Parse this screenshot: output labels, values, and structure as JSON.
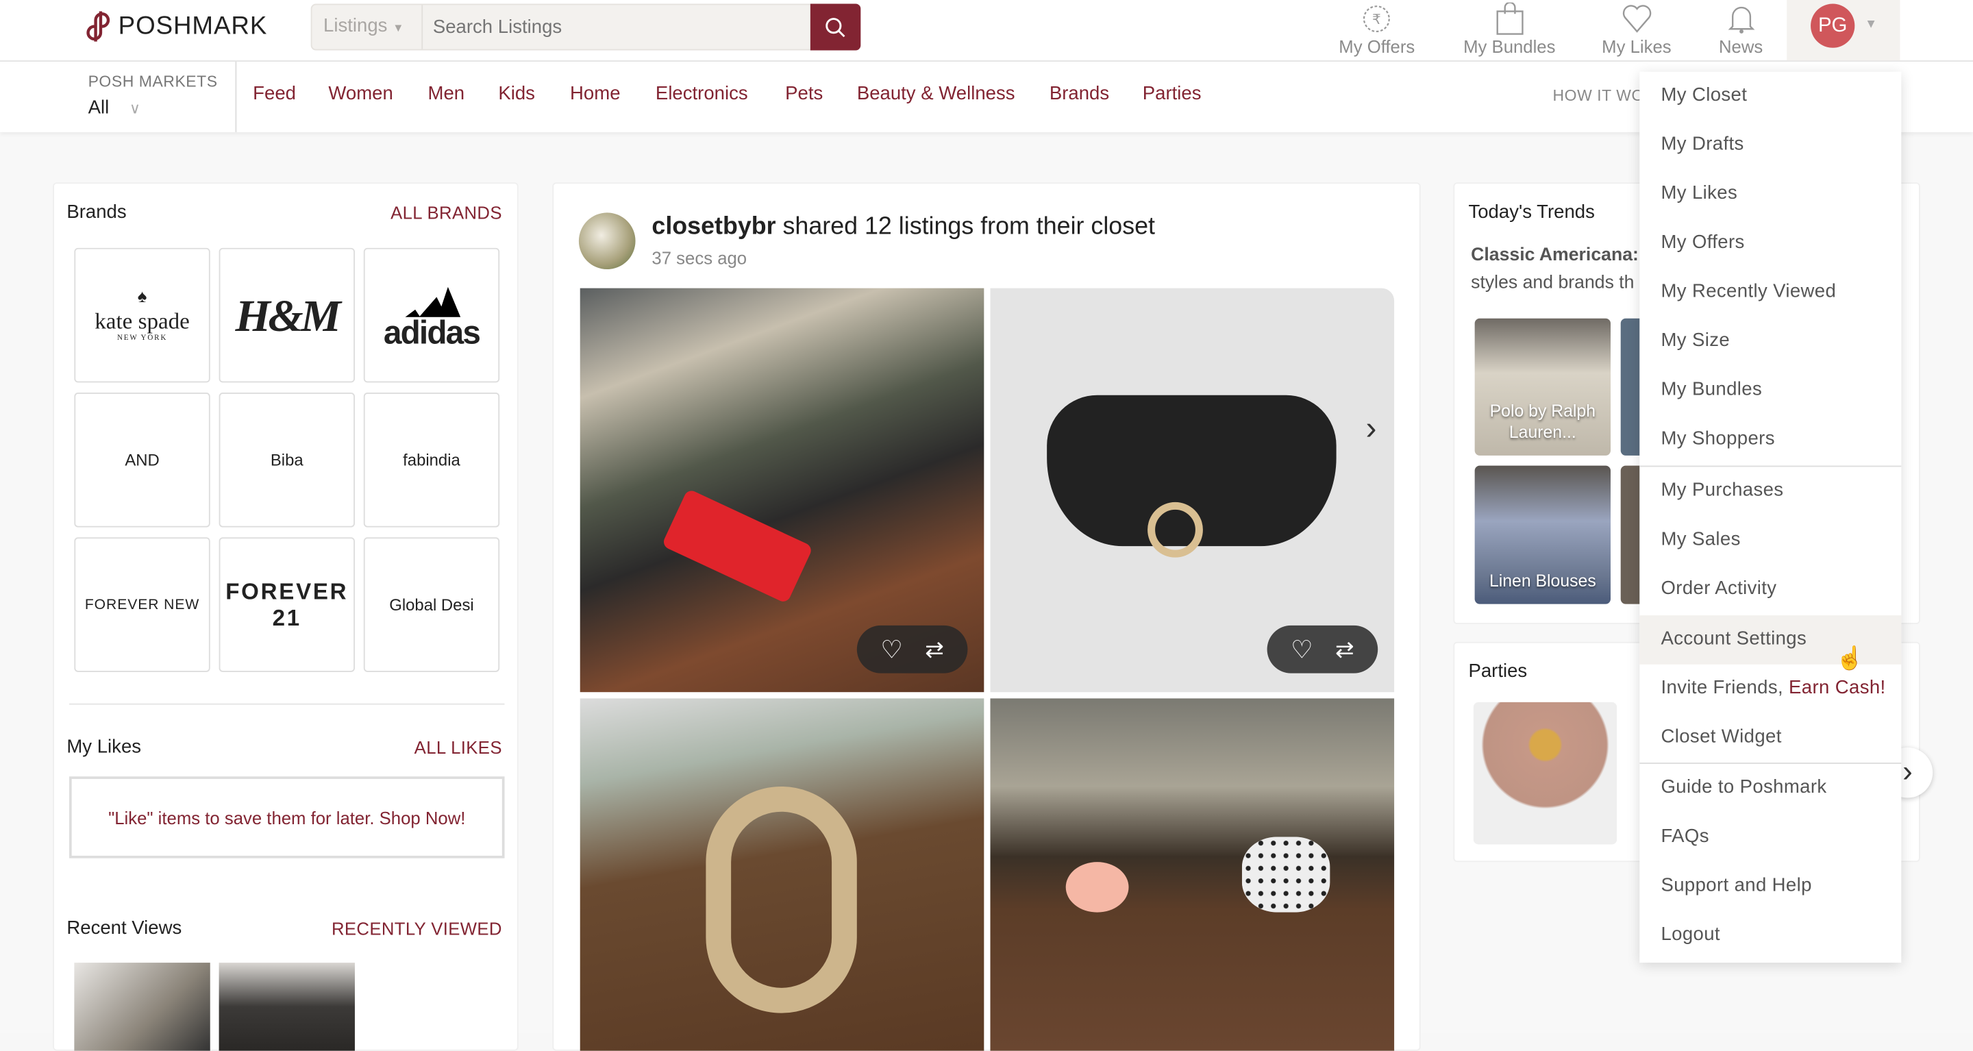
{
  "header": {
    "logo": "POSHMARK",
    "search_category": "Listings",
    "search_placeholder": "Search Listings",
    "icons": [
      {
        "label": "My Offers",
        "icon": "rupee-badge-icon"
      },
      {
        "label": "My Bundles",
        "icon": "shopping-bag-icon"
      },
      {
        "label": "My Likes",
        "icon": "heart-icon"
      },
      {
        "label": "News",
        "icon": "bell-icon"
      }
    ],
    "avatar_initials": "PG",
    "brand_color": "#822432",
    "avatar_color": "#d0575b"
  },
  "nav": {
    "markets_label": "POSH MARKETS",
    "market_value": "All",
    "links": [
      "Feed",
      "Women",
      "Men",
      "Kids",
      "Home",
      "Electronics",
      "Pets",
      "Beauty & Wellness",
      "Brands",
      "Parties"
    ],
    "how_it_works": "HOW IT WO"
  },
  "left": {
    "brands_title": "Brands",
    "all_brands": "ALL BRANDS",
    "brands": [
      "kate spade",
      "H&M",
      "adidas",
      "AND",
      "Biba",
      "fabindia",
      "FOREVER NEW",
      "FOREVER 21",
      "Global Desi"
    ],
    "kate_spade_sub": "NEW YORK",
    "likes_title": "My Likes",
    "all_likes": "ALL LIKES",
    "likes_empty": "\"Like\" items to save them for later. Shop Now!",
    "recent_title": "Recent Views",
    "recently_viewed": "RECENTLY VIEWED"
  },
  "feed": {
    "user": "closetbybr",
    "action": " shared 12 listings from their closet",
    "time": "37 secs ago"
  },
  "right": {
    "trends_title": "Today's Trends",
    "trend_heading": "Classic Americana:",
    "trend_text": "styles and brands th",
    "trends": [
      "Polo by Ralph Lauren...",
      "Linen Blouses"
    ],
    "parties_title": "Parties"
  },
  "dropdown": {
    "items": [
      "My Closet",
      "My Drafts",
      "My Likes",
      "My Offers",
      "My Recently Viewed",
      "My Size",
      "My Bundles",
      "My Shoppers",
      "My Purchases",
      "My Sales",
      "Order Activity",
      "Account Settings",
      "Invite Friends, ",
      "Closet Widget",
      "Guide to Poshmark",
      "FAQs",
      "Support and Help",
      "Logout"
    ],
    "earn_cash": "Earn Cash!",
    "highlighted": "Account Settings"
  }
}
